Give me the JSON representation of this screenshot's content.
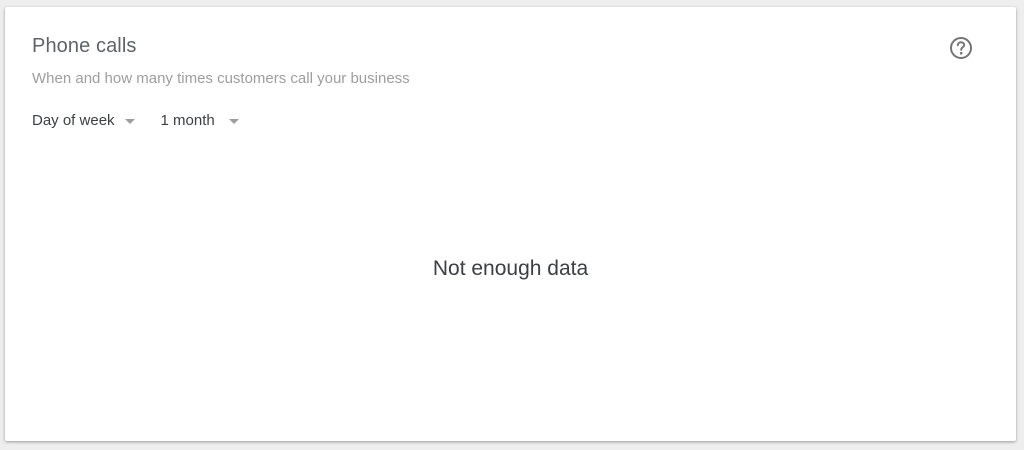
{
  "card": {
    "title": "Phone calls",
    "subtitle": "When and how many times customers call your business",
    "help_icon": "help-circle-icon"
  },
  "filters": {
    "grouping": {
      "selected": "Day of week",
      "icon": "caret-down-icon"
    },
    "range": {
      "selected": "1 month",
      "icon": "caret-down-icon"
    }
  },
  "empty_state": {
    "message": "Not enough data"
  },
  "colors": {
    "title": "#5f6368",
    "subtitle": "#9e9e9e",
    "text": "#3c4043",
    "page_bg": "#eeeeee",
    "card_bg": "#ffffff"
  }
}
